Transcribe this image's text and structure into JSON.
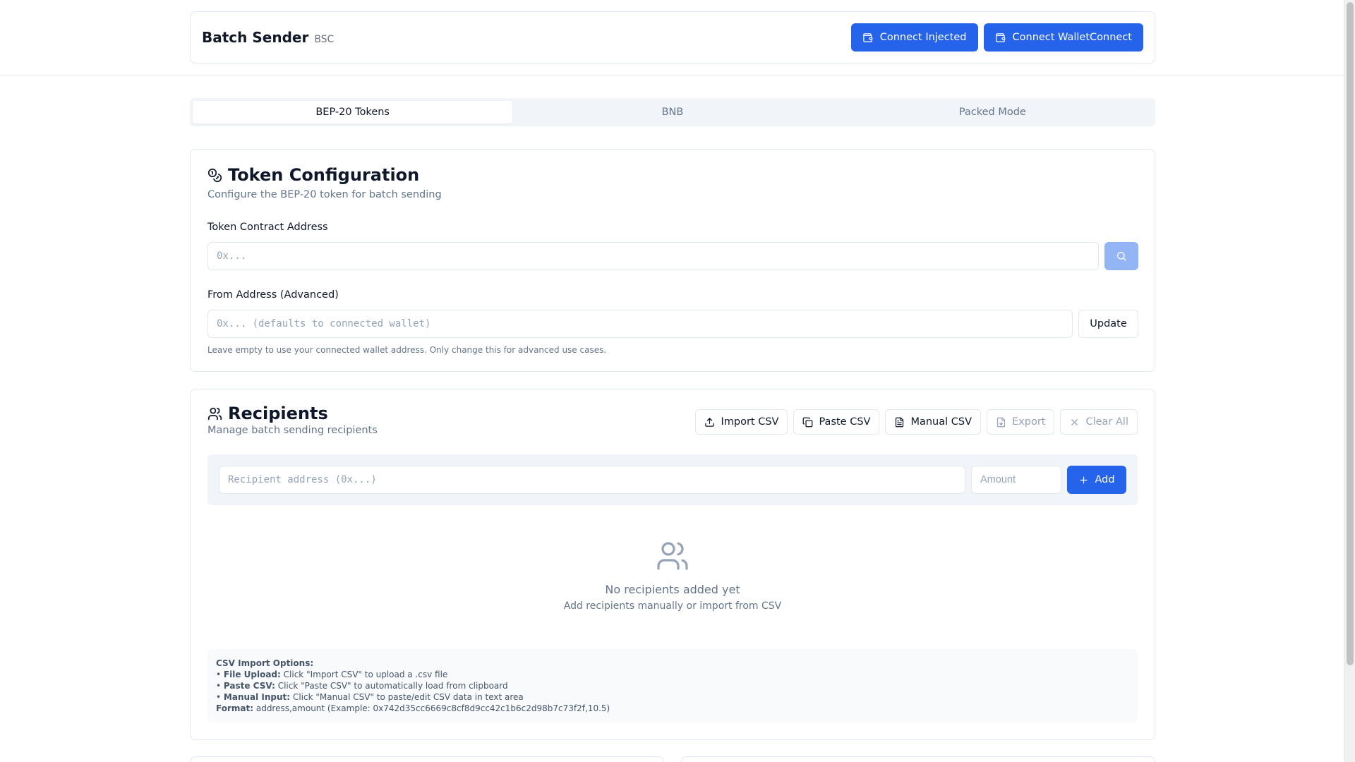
{
  "header": {
    "title": "Batch Sender",
    "chain": "BSC",
    "connect_injected": "Connect Injected",
    "connect_walletconnect": "Connect WalletConnect"
  },
  "tabs": [
    {
      "label": "BEP-20 Tokens",
      "active": true
    },
    {
      "label": "BNB",
      "active": false
    },
    {
      "label": "Packed Mode",
      "active": false
    }
  ],
  "token_config": {
    "title": "Token Configuration",
    "description": "Configure the BEP-20 token for batch sending",
    "contract_label": "Token Contract Address",
    "contract_placeholder": "0x...",
    "from_label": "From Address (Advanced)",
    "from_placeholder": "0x... (defaults to connected wallet)",
    "update_label": "Update",
    "hint": "Leave empty to use your connected wallet address. Only change this for advanced use cases."
  },
  "recipients": {
    "title": "Recipients",
    "description": "Manage batch sending recipients",
    "import_csv": "Import CSV",
    "paste_csv": "Paste CSV",
    "manual_csv": "Manual CSV",
    "export": "Export",
    "clear_all": "Clear All",
    "address_placeholder": "Recipient address (0x...)",
    "amount_placeholder": "Amount",
    "add_label": "Add",
    "empty_title": "No recipients added yet",
    "empty_subtitle": "Add recipients manually or import from CSV",
    "help": {
      "heading": "CSV Import Options:",
      "file_upload_label": "File Upload:",
      "file_upload_text": "Click \"Import CSV\" to upload a .csv file",
      "paste_label": "Paste CSV:",
      "paste_text": "Click \"Paste CSV\" to automatically load from clipboard",
      "manual_label": "Manual Input:",
      "manual_text": "Click \"Manual CSV\" to paste/edit CSV data in text area",
      "format_label": "Format:",
      "format_text": "address,amount (Example: 0x742d35cc6669c8cf8d9cc42c1b6c2d98b7c73f2f,10.5)"
    }
  },
  "colors": {
    "primary": "#2563eb",
    "primary_light": "#93b4f5",
    "muted_text": "#64748b",
    "border": "#e2e8f0"
  }
}
